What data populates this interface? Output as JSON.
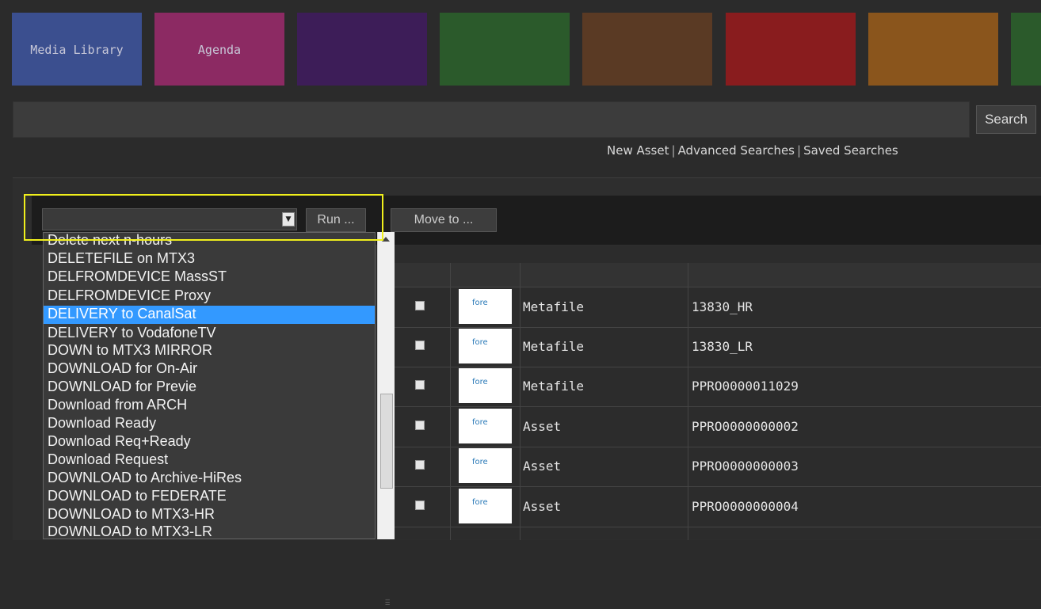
{
  "nav_tiles": [
    {
      "label": "Media Library",
      "color": "#3b4f8f"
    },
    {
      "label": "Agenda",
      "color": "#8c2a63"
    },
    {
      "label": "",
      "color": "#3d1d58"
    },
    {
      "label": "",
      "color": "#2b5a2b"
    },
    {
      "label": "",
      "color": "#5a3a24"
    },
    {
      "label": "",
      "color": "#891c1e"
    },
    {
      "label": "",
      "color": "#8a551c"
    },
    {
      "label": "",
      "color": "#2b5a2b"
    }
  ],
  "search": {
    "value": "",
    "button_label": "Search"
  },
  "links": {
    "new_asset": "New Asset",
    "advanced_searches": "Advanced Searches",
    "saved_searches": "Saved Searches",
    "separator": "|"
  },
  "toolbar": {
    "select_value": "",
    "run_label": "Run ...",
    "move_label": "Move to ..."
  },
  "dropdown": {
    "items": [
      "Delete next n-hours",
      "DELETEFILE on MTX3",
      "DELFROMDEVICE MassST",
      "DELFROMDEVICE Proxy",
      "DELIVERY to CanalSat",
      "DELIVERY to VodafoneTV",
      "DOWN to MTX3 MIRROR",
      "DOWNLOAD for On-Air",
      "DOWNLOAD for Previe",
      "Download from ARCH",
      "Download Ready",
      "Download Req+Ready",
      "Download Request",
      "DOWNLOAD to Archive-HiRes",
      "DOWNLOAD to FEDERATE",
      "DOWNLOAD to MTX3-HR",
      "DOWNLOAD to MTX3-LR"
    ],
    "selected_index": 4
  },
  "table": {
    "rows": [
      {
        "type": "Metafile",
        "name": "13830_HR"
      },
      {
        "type": "Metafile",
        "name": "13830_LR"
      },
      {
        "type": "Metafile",
        "name": "PPRO0000011029"
      },
      {
        "type": "Asset",
        "name": "PPRO0000000002"
      },
      {
        "type": "Asset",
        "name": "PPRO0000000003"
      },
      {
        "type": "Asset",
        "name": "PPRO0000000004"
      }
    ],
    "thumb_label": "fore"
  }
}
